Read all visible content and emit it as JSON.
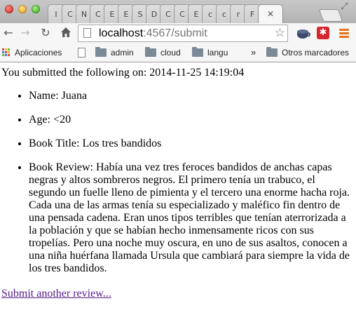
{
  "browser": {
    "tabs": [
      {
        "glyph": "I"
      },
      {
        "glyph": "C"
      },
      {
        "glyph": "N"
      },
      {
        "glyph": "C"
      },
      {
        "glyph": "E"
      },
      {
        "glyph": "E"
      },
      {
        "glyph": "S"
      },
      {
        "glyph": "D"
      },
      {
        "glyph": "C"
      },
      {
        "glyph": "C"
      },
      {
        "glyph": "E"
      },
      {
        "glyph": "c"
      },
      {
        "glyph": "c"
      },
      {
        "glyph": "r"
      },
      {
        "glyph": "F"
      }
    ],
    "active_tab_close": "✕",
    "url_host": "localhost",
    "url_rest": ":4567/submit",
    "bookmarks": {
      "apps": "Aplicaciones",
      "folders": [
        "admin",
        "cloud",
        "langu"
      ],
      "more": "»",
      "other": "Otros marcadores"
    }
  },
  "page": {
    "intro": "You submitted the following on: 2014-11-25 14:19:04",
    "fields": [
      {
        "label": "Name:",
        "value": "Juana"
      },
      {
        "label": "Age:",
        "value": "<20"
      },
      {
        "label": "Book Title:",
        "value": "Los tres bandidos"
      },
      {
        "label": "Book Review:",
        "value": "Había una vez tres feroces bandidos de anchas capas negras y altos sombreros negros. El primero tenía un trabuco, el segundo un fuelle lleno de pimienta y el tercero una enorme hacha roja. Cada una de las armas tenía su especializado y maléfico fin dentro de una pensada cadena. Eran unos tipos terribles que tenían aterrorizada a la población y que se habían hecho inmensamente ricos con sus tropelías. Pero una noche muy oscura, en uno de sus asaltos, conocen a una niña huérfana llamada Ursula que cambiará para siempre la vida de los tres bandidos."
      }
    ],
    "link": "Submit another review..."
  },
  "colors": {
    "link_visited": "#551a8b",
    "menu_accent": "#e8731c",
    "extension_red": "#d3262d"
  }
}
